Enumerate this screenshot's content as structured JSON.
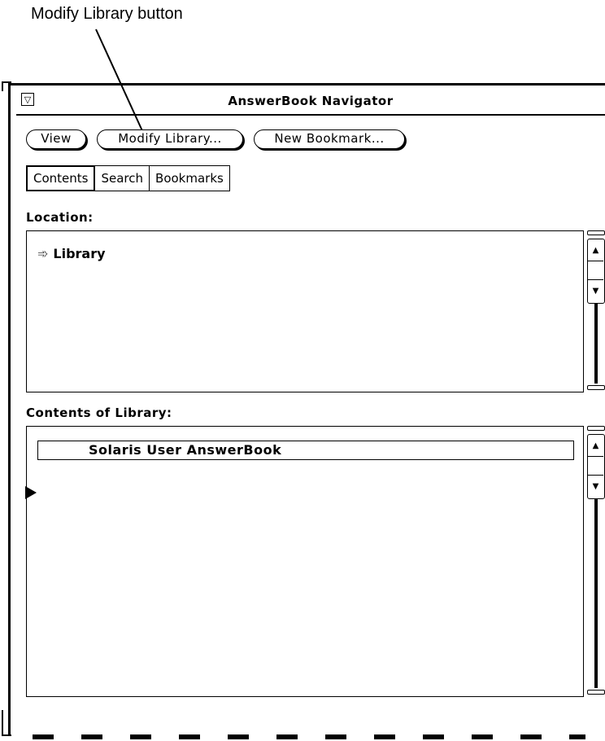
{
  "callout": {
    "label": "Modify Library button"
  },
  "window": {
    "title": "AnswerBook Navigator",
    "menu_icon": "window-menu-icon",
    "menu_glyph": "▽"
  },
  "buttons": {
    "view": "View",
    "modify_library": "Modify Library...",
    "new_bookmark": "New Bookmark..."
  },
  "tabs": [
    {
      "label": "Contents",
      "active": true
    },
    {
      "label": "Search",
      "active": false
    },
    {
      "label": "Bookmarks",
      "active": false
    }
  ],
  "location": {
    "label": "Location:",
    "item": "Library",
    "item_icon": "arrow-icon",
    "item_glyph": "➾"
  },
  "contents": {
    "label": "Contents of Library:",
    "items": [
      {
        "label": "Solaris User AnswerBook"
      }
    ],
    "pointer_icon": "pointer-icon"
  },
  "scrollbar": {
    "up_glyph": "▲",
    "down_glyph": "▼"
  }
}
